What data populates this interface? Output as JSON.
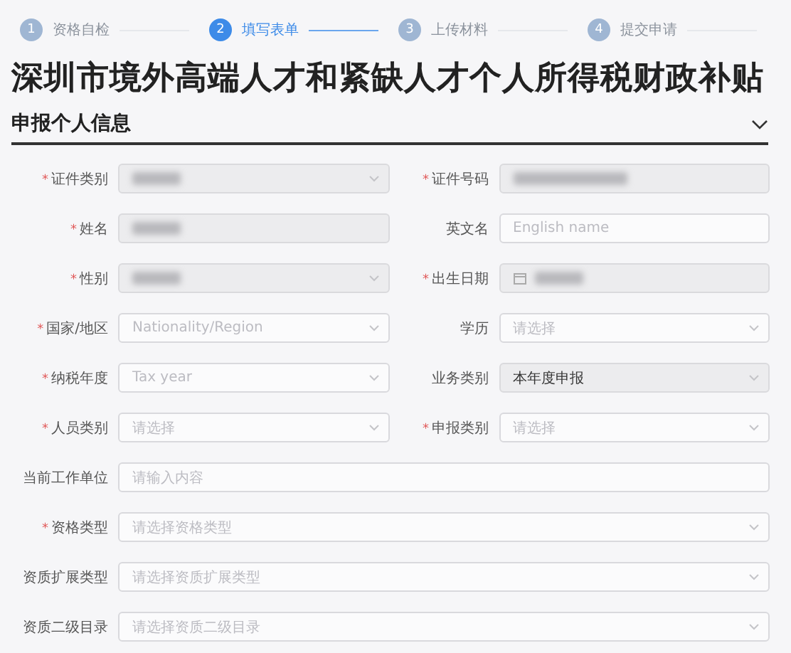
{
  "steps": [
    {
      "number": "1",
      "label": "资格自检",
      "selected": false
    },
    {
      "number": "2",
      "label": "填写表单",
      "selected": true
    },
    {
      "number": "3",
      "label": "上传材料",
      "selected": false
    },
    {
      "number": "4",
      "label": "提交申请",
      "selected": false
    }
  ],
  "required_mark": "*",
  "title": "深圳市境外高端人才和紧缺人才个人所得税财政补贴",
  "section": {
    "title": "申报个人信息",
    "expanded": true
  },
  "rows": [
    {
      "fields": [
        {
          "label": "证件类别",
          "required": true,
          "kind": "select",
          "disabled": true,
          "redacted": true
        },
        {
          "label": "证件号码",
          "required": true,
          "kind": "input",
          "disabled": true,
          "redacted": true
        }
      ]
    },
    {
      "fields": [
        {
          "label": "姓名",
          "required": true,
          "kind": "input",
          "disabled": true,
          "redacted": true
        },
        {
          "label": "英文名",
          "required": false,
          "kind": "input",
          "disabled": false,
          "placeholder": "English name"
        }
      ]
    },
    {
      "fields": [
        {
          "label": "性别",
          "required": true,
          "kind": "select",
          "disabled": true,
          "redacted": true
        },
        {
          "label": "出生日期",
          "required": true,
          "kind": "date",
          "disabled": true,
          "redacted": true
        }
      ]
    },
    {
      "fields": [
        {
          "label": "国家/地区",
          "required": true,
          "kind": "select",
          "disabled": false,
          "placeholder": "Nationality/Region"
        },
        {
          "label": "学历",
          "required": false,
          "kind": "select",
          "disabled": false,
          "placeholder": "请选择"
        }
      ]
    },
    {
      "fields": [
        {
          "label": "纳税年度",
          "required": true,
          "kind": "select",
          "disabled": false,
          "placeholder": "Tax year"
        },
        {
          "label": "业务类别",
          "required": false,
          "kind": "select",
          "disabled": true,
          "value": "本年度申报"
        }
      ]
    },
    {
      "fields": [
        {
          "label": "人员类别",
          "required": true,
          "kind": "select",
          "disabled": false,
          "placeholder": "请选择"
        },
        {
          "label": "申报类别",
          "required": true,
          "kind": "select",
          "disabled": false,
          "placeholder": "请选择"
        }
      ]
    },
    {
      "fields": [
        {
          "label": "当前工作单位",
          "required": false,
          "kind": "input",
          "disabled": false,
          "placeholder": "请输入内容"
        }
      ]
    },
    {
      "fields": [
        {
          "label": "资格类型",
          "required": true,
          "kind": "select",
          "disabled": false,
          "placeholder": "请选择资格类型"
        }
      ]
    },
    {
      "fields": [
        {
          "label": "资质扩展类型",
          "required": false,
          "kind": "select",
          "disabled": false,
          "placeholder": "请选择资质扩展类型"
        }
      ]
    },
    {
      "fields": [
        {
          "label": "资质二级目录",
          "required": false,
          "kind": "select",
          "disabled": false,
          "placeholder": "请选择资质二级目录"
        }
      ]
    }
  ]
}
